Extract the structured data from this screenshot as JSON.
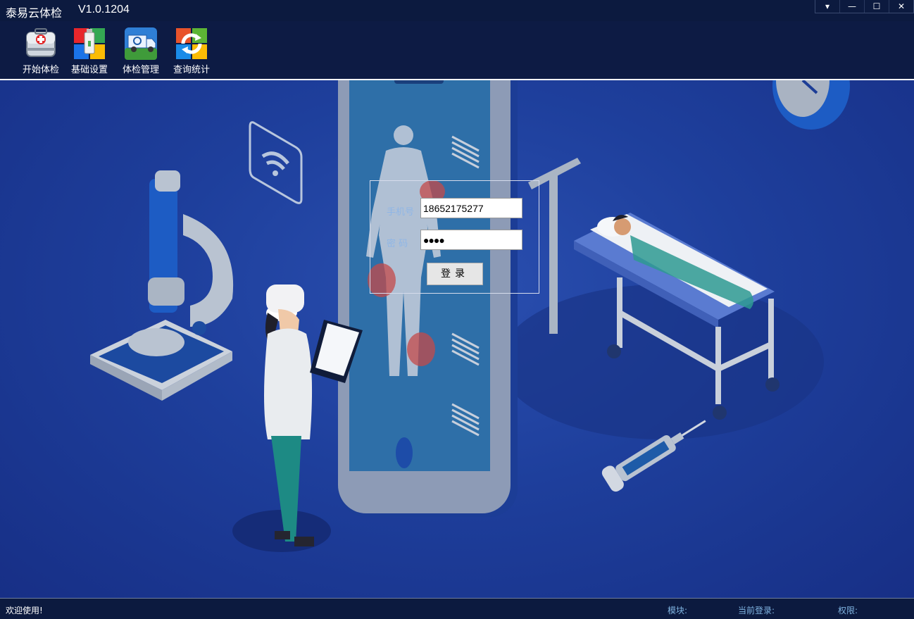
{
  "window": {
    "title": "泰易云体检",
    "version": "V1.0.1204",
    "controls": [
      "▾",
      "—",
      "☐",
      "✕"
    ]
  },
  "toolbar": {
    "items": [
      {
        "label": "开始体检",
        "icon": "medkit-icon"
      },
      {
        "label": "基础设置",
        "icon": "settings-usb-icon"
      },
      {
        "label": "体检管理",
        "icon": "truck-icon"
      },
      {
        "label": "查询统计",
        "icon": "refresh-stats-icon"
      }
    ]
  },
  "login": {
    "phone_label": "手机号",
    "phone_value": "18652175277",
    "password_label": "密 码",
    "password_value": "●●●●",
    "login_button": "登录"
  },
  "status": {
    "welcome": "欢迎使用!",
    "module_label": "模块:",
    "current_login_label": "当前登录:",
    "permission_label": "权限:"
  },
  "colors": {
    "bg_blue": "#1e3f9c",
    "title_bar": "#0c1a3f",
    "label_blue": "#8fb6e6",
    "status_label": "#7fb3e0"
  }
}
